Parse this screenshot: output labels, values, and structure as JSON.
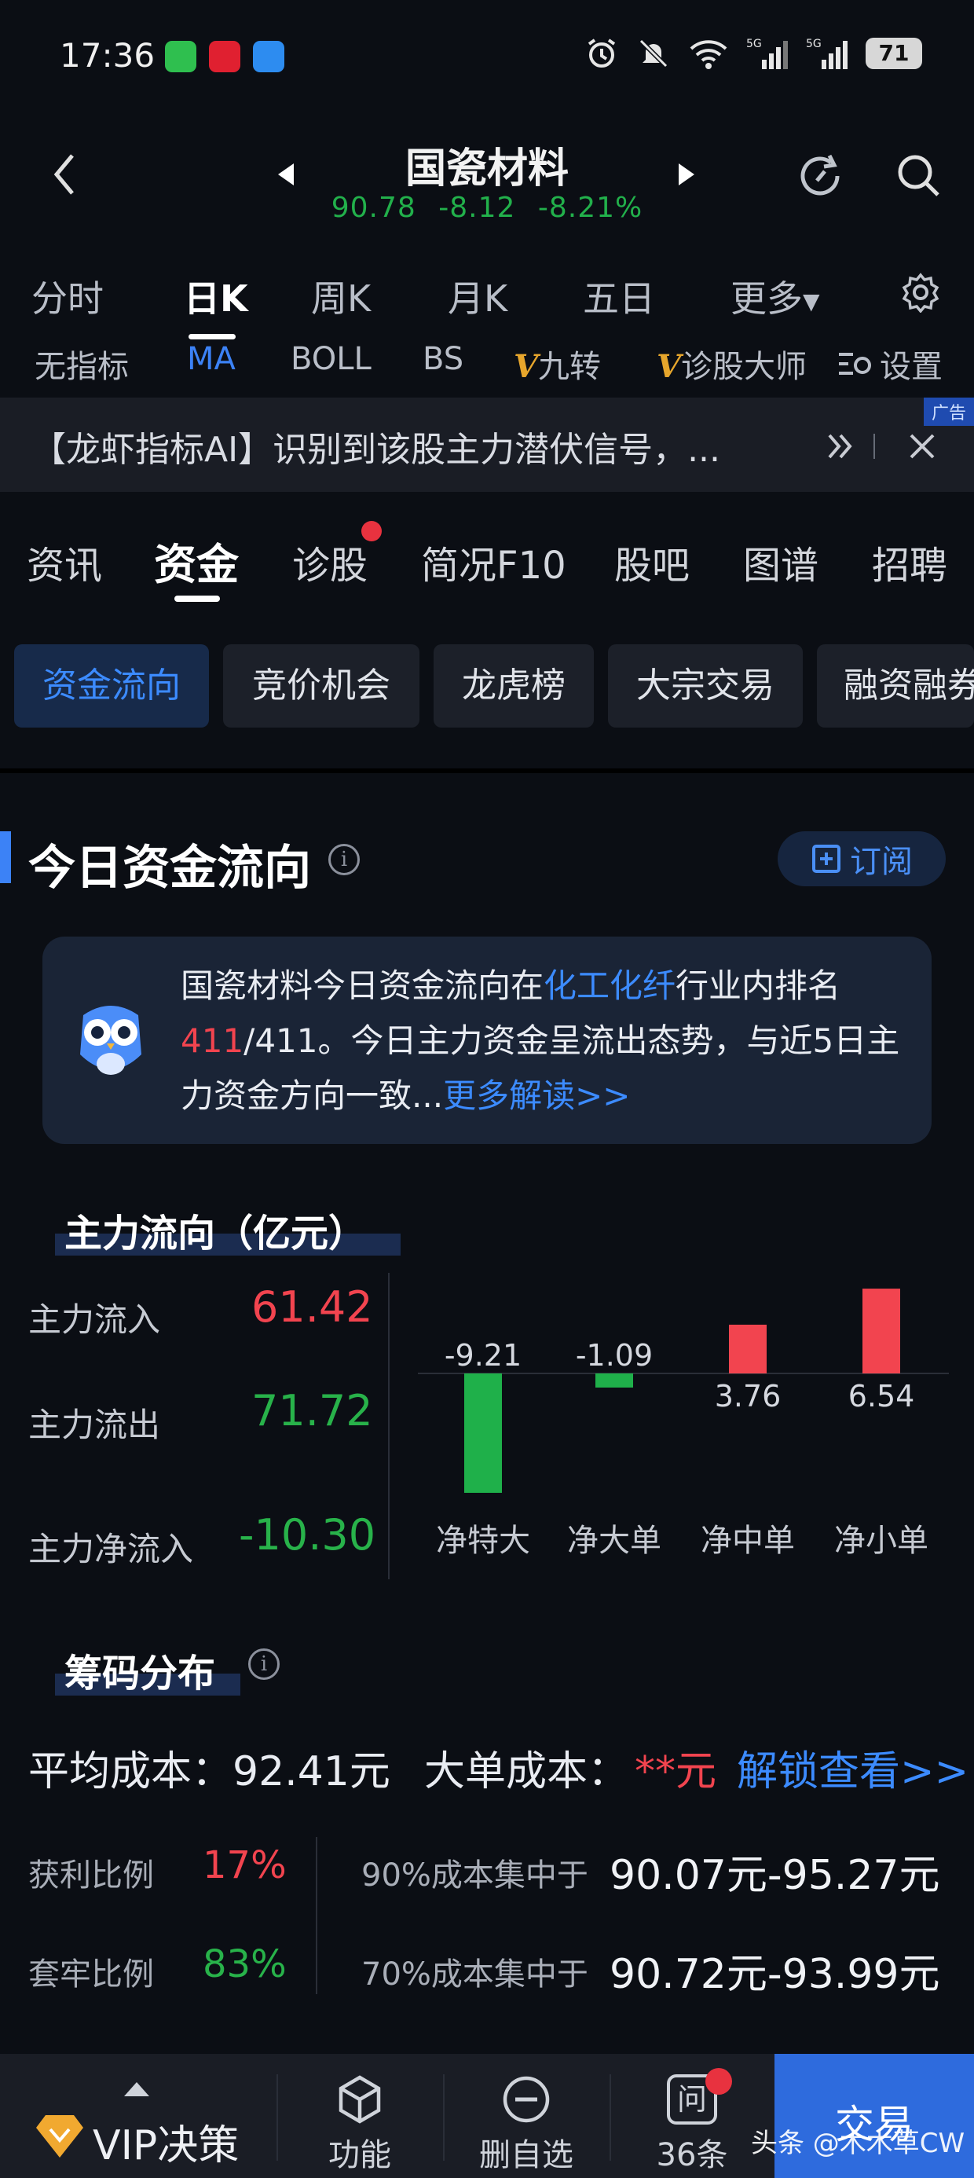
{
  "status_bar": {
    "time": "17:36",
    "battery": "71",
    "net1": "5G",
    "net2": "5G"
  },
  "header": {
    "stock_name": "国瓷材料",
    "price": "90.78",
    "change": "-8.12",
    "change_pct": "-8.21%"
  },
  "periods": [
    "分时",
    "日K",
    "周K",
    "月K",
    "五日",
    "更多"
  ],
  "indicators": {
    "none": "无指标",
    "ma": "MA",
    "boll": "BOLL",
    "bs": "BS",
    "v_mark": "V",
    "jiuzhuan": "九转",
    "dashi": "诊股大师",
    "settings": "设置"
  },
  "ad": {
    "text": "【龙虾指标AI】识别到该股主力潜伏信号，...",
    "tag": "广告"
  },
  "tabs": [
    "资讯",
    "资金",
    "诊股",
    "简况F10",
    "股吧",
    "图谱",
    "招聘"
  ],
  "chips": [
    "资金流向",
    "竞价机会",
    "龙虎榜",
    "大宗交易",
    "融资融券"
  ],
  "section": {
    "title": "今日资金流向",
    "subscribe": "订阅",
    "info": "i"
  },
  "ai_card": {
    "part1": "国瓷材料今日资金流向在",
    "industry": "化工化纤",
    "part2": "行业内排名",
    "rank": "411",
    "part3": "/411。今日主力资金呈流出态势，与近5日主力资金方向一致...",
    "more": "更多解读>>"
  },
  "main_flow": {
    "title": "主力流向（亿元）",
    "inflow_label": "主力流入",
    "inflow": "61.42",
    "outflow_label": "主力流出",
    "outflow": "71.72",
    "net_label": "主力净流入",
    "net": "-10.30"
  },
  "chart_data": {
    "type": "bar",
    "categories": [
      "净特大",
      "净大单",
      "净中单",
      "净小单"
    ],
    "values": [
      -9.21,
      -1.09,
      3.76,
      6.54
    ],
    "value_labels": [
      "-9.21",
      "-1.09",
      "3.76",
      "6.54"
    ],
    "colors": {
      "positive": "#f2444f",
      "negative": "#1fb04a"
    }
  },
  "chips_dist": {
    "title": "筹码分布",
    "avg_cost_label": "平均成本：",
    "avg_cost": "92.41元",
    "big_cost_label": "大单成本：",
    "big_cost": "**元",
    "unlock": "解锁查看>>",
    "profit_label": "获利比例",
    "profit": "17%",
    "trapped_label": "套牢比例",
    "trapped": "83%",
    "c90_label": "90%成本集中于",
    "c90": "90.07元-95.27元",
    "c70_label": "70%成本集中于",
    "c70": "90.72元-93.99元"
  },
  "bottom_bar": {
    "vip": "VIP决策",
    "func": "功能",
    "remove": "删自选",
    "ask": "36条",
    "ask_icon": "问",
    "trade": "交易"
  },
  "watermark": "头条 @木木草CW",
  "colors": {
    "accent": "#3c82f6",
    "up": "#f2444f",
    "down": "#28b24a",
    "bg": "#0b0e14"
  }
}
